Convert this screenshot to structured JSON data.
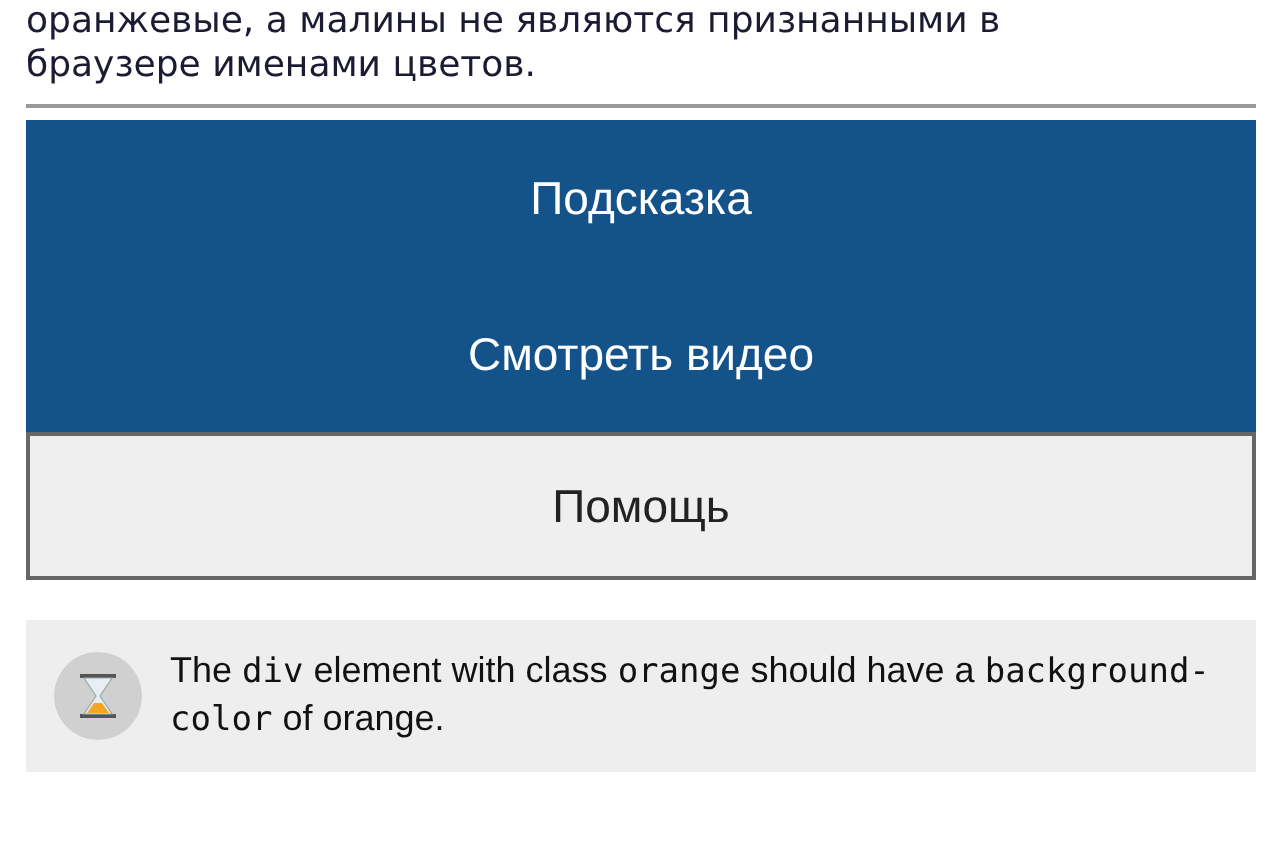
{
  "description": "оранжевые, а малины не являются признанными в браузере именами цветов.",
  "buttons": [
    {
      "label": "Подсказка",
      "kind": "primary"
    },
    {
      "label": "Смотреть видео",
      "kind": "primary"
    },
    {
      "label": "Помощь",
      "kind": "secondary"
    }
  ],
  "hint": {
    "segments": [
      {
        "kind": "text",
        "text": "The "
      },
      {
        "kind": "code",
        "text": "div"
      },
      {
        "kind": "text",
        "text": " element with class "
      },
      {
        "kind": "code",
        "text": "orange"
      },
      {
        "kind": "text",
        "text": " should have a "
      },
      {
        "kind": "code",
        "text": "background-color"
      },
      {
        "kind": "text",
        "text": " of orange."
      }
    ]
  }
}
